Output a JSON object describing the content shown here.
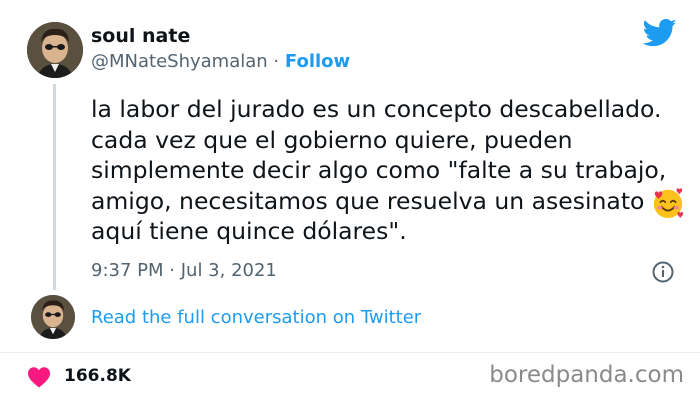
{
  "author": {
    "name": "soul nate",
    "handle": "@MNateShyamalan",
    "separator": "·",
    "follow_label": "Follow"
  },
  "tweet": {
    "text": "la labor del jurado es un concepto descabellado.\ncada vez que el gobierno quiere, pueden\nsimplemente decir algo como \"falte a su trabajo,\namigo, necesitamos que resuelva un asesinato\naquí tiene quince dólares\".",
    "emoji": "smiling-face-with-hearts",
    "time": "9:37 PM",
    "separator": "·",
    "date": "Jul 3, 2021"
  },
  "conversation": {
    "link_label": "Read the full conversation on Twitter"
  },
  "engagement": {
    "likes": "166.8K"
  },
  "watermark": "boredpanda.com",
  "colors": {
    "accent": "#1d9bf0",
    "heart": "#f91880",
    "muted": "#536471"
  },
  "icons": [
    "twitter-bird-icon",
    "info-icon",
    "heart-icon"
  ]
}
